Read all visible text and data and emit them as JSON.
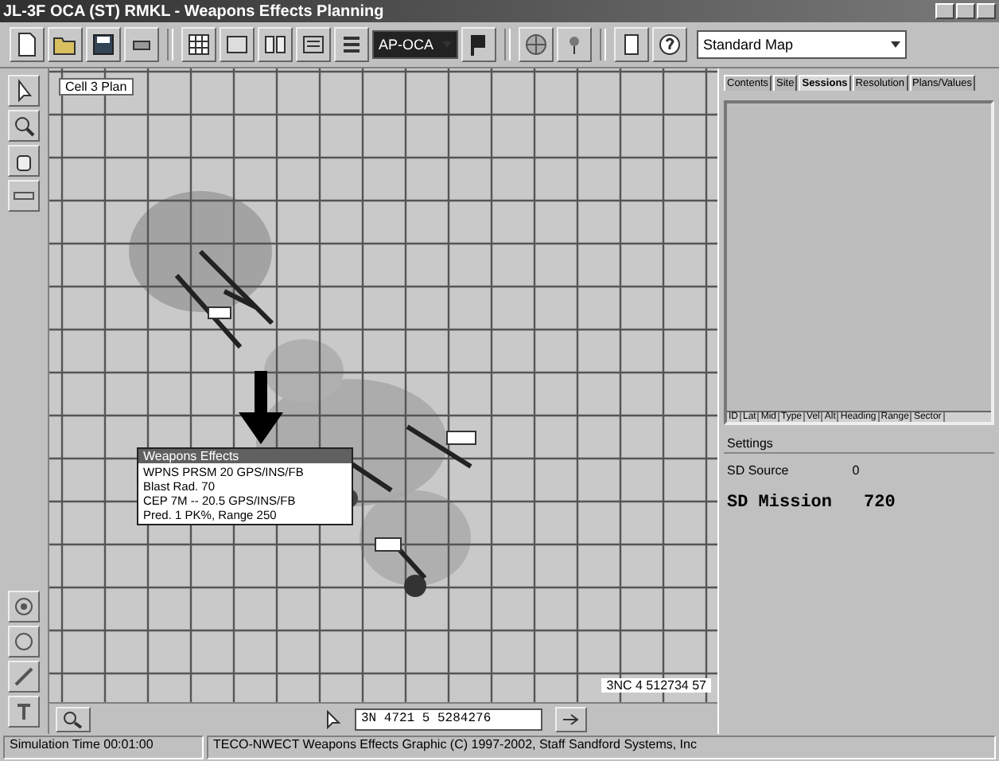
{
  "window": {
    "title": "JL-3F OCA (ST) RMKL - Weapons Effects Planning"
  },
  "toolbar": {
    "mode_dropdown": "AP-OCA",
    "map_dropdown": "Standard Map"
  },
  "map": {
    "plan_label": "Cell 3 Plan",
    "scale_label": "3NC 4 512734 57",
    "tooltip": {
      "title": "Weapons Effects",
      "lines": [
        "WPNS PRSM 20 GPS/INS/FB",
        "Blast Rad. 70",
        "CEP 7M -- 20.5 GPS/INS/FB",
        "Pred. 1 PK%, Range 250"
      ]
    }
  },
  "side_panel": {
    "tabs": [
      {
        "label": "Contents",
        "selected": false
      },
      {
        "label": "Site",
        "selected": false
      },
      {
        "label": "Sessions",
        "selected": true
      },
      {
        "label": "Resolution",
        "selected": false
      },
      {
        "label": "Plans/Values",
        "selected": false
      }
    ],
    "list_columns": [
      "ID",
      "Lat",
      "Mid",
      "Type",
      "Vel",
      "Alt",
      "Heading",
      "Range",
      "Sector"
    ],
    "section_label": "Settings",
    "fields": [
      {
        "label": "SD Source",
        "value": "0",
        "kind": "normal"
      },
      {
        "label": "SD Mission",
        "value": "720",
        "kind": "large"
      }
    ]
  },
  "coordinate_field": {
    "value": "3N 4721 5 5284276"
  },
  "status_bar": [
    "Simulation Time 00:01:00",
    "TECO-NWECT Weapons Effects Graphic (C) 1997-2002, Staff Sandford Systems, Inc"
  ]
}
